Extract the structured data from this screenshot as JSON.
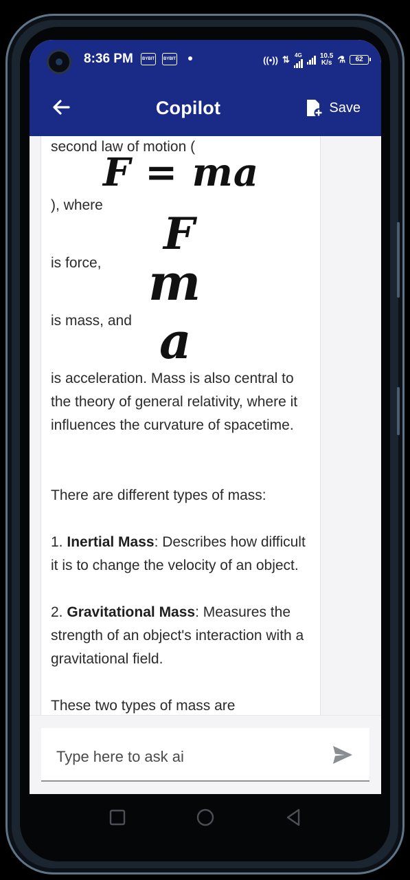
{
  "status_bar": {
    "time": "8:36 PM",
    "badge_1": "BYBIT",
    "badge_2": "BYBIT",
    "net_type": "4G",
    "speed_value": "10.5",
    "speed_unit": "K/s",
    "battery": "62",
    "icons": [
      "hotspot-icon",
      "data-arrows-icon",
      "signal-icon",
      "signal-icon",
      "flask-icon",
      "battery-icon"
    ]
  },
  "app_bar": {
    "title": "Copilot",
    "save_label": "Save",
    "icons": [
      "back-arrow-icon",
      "save-document-icon"
    ]
  },
  "message": {
    "line_1": "second law of motion (",
    "eq_1": "F = ma",
    "line_2": "), where",
    "var_f": "F",
    "line_3": " is force,",
    "var_m": "m",
    "line_4": " is mass, and",
    "var_a": "a",
    "para_1": " is acceleration. Mass is also central to the theory of general relativity, where it influences the curvature of spacetime.",
    "para_2": "There are different types of mass:",
    "item_1_number": "1.",
    "item_1_title": "Inertial Mass",
    "item_1_text": ": Describes how difficult it is to change the velocity of an object.",
    "item_2_number": "2.",
    "item_2_title": "Gravitational Mass",
    "item_2_text": ": Measures the strength of an object's interaction with a gravitational field.",
    "para_3": "These two types of mass are"
  },
  "input": {
    "placeholder": "Type here to ask ai",
    "value": ""
  },
  "nav_bar": {
    "icons": [
      "recents-square-icon",
      "home-circle-icon",
      "back-triangle-icon"
    ]
  }
}
